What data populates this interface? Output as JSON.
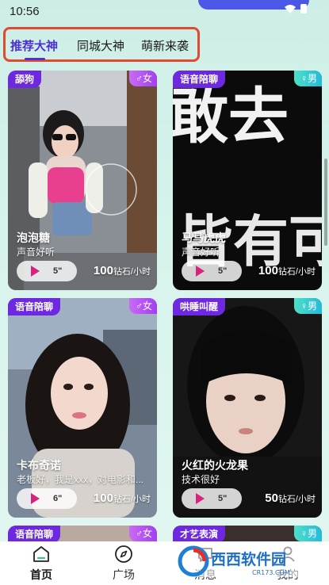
{
  "status_bar": {
    "time": "10:56"
  },
  "tabs": [
    {
      "label": "推荐大神",
      "active": true
    },
    {
      "label": "同城大神",
      "active": false
    },
    {
      "label": "萌新来袭",
      "active": false
    }
  ],
  "cards": [
    {
      "tag": "舔狗",
      "gender": "♂女",
      "name": "泡泡糖",
      "desc": "声音好听",
      "duration": "5\"",
      "price": "100",
      "unit": "钻石/小时"
    },
    {
      "tag": "语音陪聊",
      "gender": "♀男",
      "name": "马马虎虎",
      "desc": "声音好听",
      "duration": "5\"",
      "price": "100",
      "unit": "钻石/小时",
      "poster_text_1": "敢去",
      "poster_text_2": "皆有可"
    },
    {
      "tag": "语音陪聊",
      "gender": "♂女",
      "name": "卡布奇诺",
      "desc": "老板好，我是xxx，对电影和...",
      "duration": "6\"",
      "price": "100",
      "unit": "钻石/小时"
    },
    {
      "tag": "哄睡叫醒",
      "gender": "♀男",
      "name": "火红的火龙果",
      "desc": "技术很好",
      "duration": "5\"",
      "price": "50",
      "unit": "钻石/小时"
    },
    {
      "tag": "语音陪聊",
      "gender": "♂女"
    },
    {
      "tag": "才艺表演",
      "gender": "♀男"
    }
  ],
  "nav": [
    {
      "label": "首页",
      "icon": "home-icon",
      "active": true
    },
    {
      "label": "广场",
      "icon": "compass-icon",
      "active": false
    },
    {
      "label": "消息",
      "icon": "message-icon",
      "active": false
    },
    {
      "label": "我的",
      "icon": "profile-icon",
      "active": false
    }
  ],
  "watermark": {
    "brand": "西西软件园",
    "domain": "CR173.COM"
  },
  "colors": {
    "accent": "#4f2fd6",
    "tag_bg": "#6d28e0",
    "highlight_box": "#e04a2e",
    "play": "#d8237d"
  }
}
